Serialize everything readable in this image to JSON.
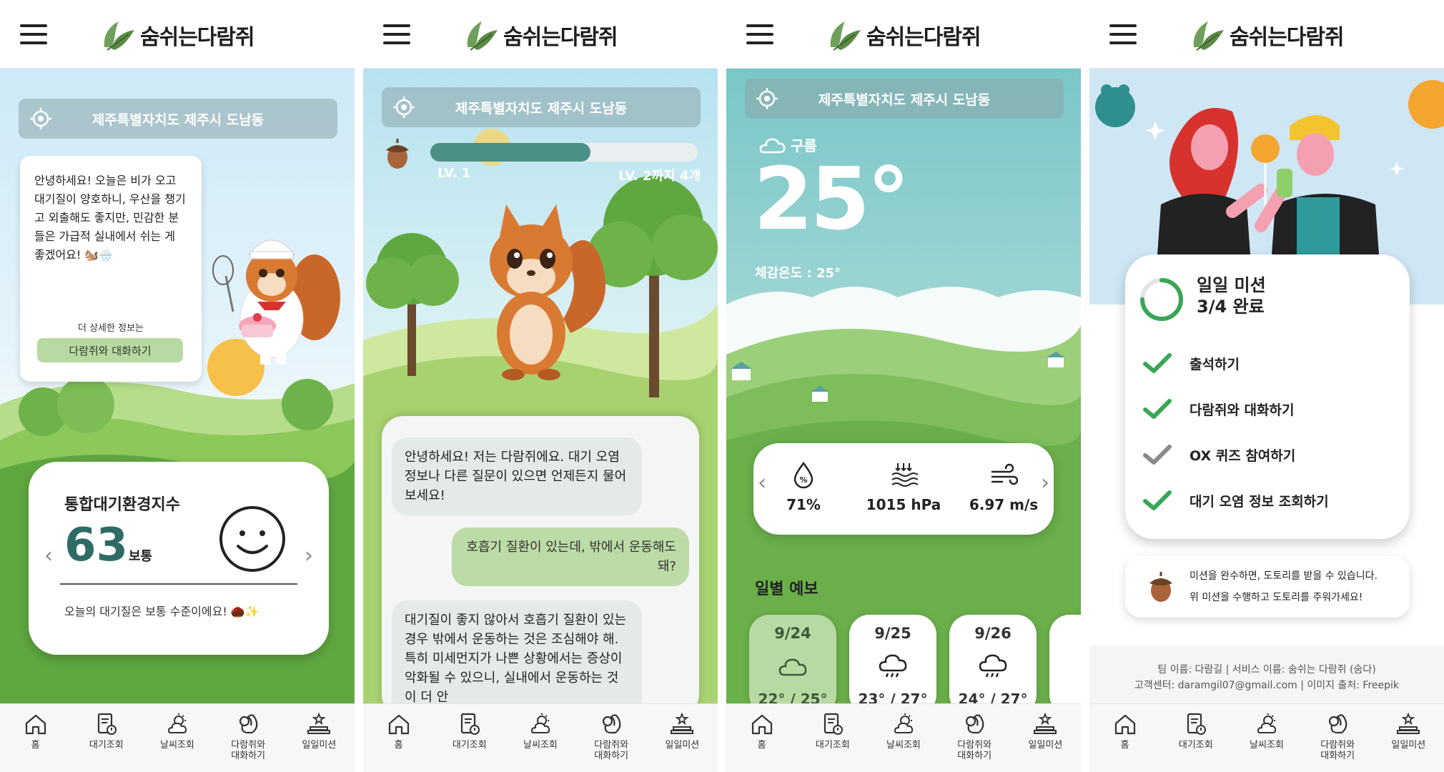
{
  "app": {
    "logo_text": "숨쉬는다람쥐",
    "nav": [
      {
        "label": "홈"
      },
      {
        "label": "대기조회"
      },
      {
        "label": "날씨조회"
      },
      {
        "label": "다람쥐와\n대화하기"
      },
      {
        "label": "일일미션"
      }
    ]
  },
  "location": "제주특별자치도 제주시 도남동",
  "home": {
    "greeting": "안녕하세요! 오늘은 비가 오고 대기질이 양호하니, 우산을 챙기고 외출해도 좋지만, 민감한 분들은 가급적 실내에서 쉬는 게 좋겠어요! 🐿️🌧️",
    "more_label": "더 상세한 정보는",
    "chat_button": "다람쥐와 대화하기",
    "aqi_title": "통합대기환경지수",
    "aqi_value": "63",
    "aqi_status": "보통",
    "aqi_message": "오늘의 대기질은 보통 수준이에요! 🌰✨"
  },
  "chat": {
    "level": {
      "current": "LV. 1",
      "next": "LV. 2까지 4개",
      "progress": 0.6
    },
    "messages": [
      {
        "role": "bot",
        "text": "안녕하세요! 저는 다람쥐에요. 대기 오염 정보나 다른 질문이 있으면 언제든지 물어보세요!"
      },
      {
        "role": "user",
        "text": "호흡기 질환이 있는데, 밖에서 운동해도 돼?"
      },
      {
        "role": "bot",
        "text": "대기질이 좋지 않아서 호흡기 질환이 있는 경우 밖에서 운동하는 것은 조심해야 해. 특히 미세먼지가 나쁜 상황에서는 증상이 악화될 수 있으니, 실내에서 운동하는 것이 더 안"
      }
    ]
  },
  "weather": {
    "condition": "구름",
    "temperature": "25°",
    "feels_like": "체감온도 : 25°",
    "humidity": "71%",
    "pressure": "1015 hPa",
    "wind": "6.97 m/s",
    "forecast_title": "일별 예보",
    "forecast": [
      {
        "date": "9/24",
        "temp": "22° / 25°",
        "icon": "cloud-icon"
      },
      {
        "date": "9/25",
        "temp": "23° / 27°",
        "icon": "rain-cloud-icon"
      },
      {
        "date": "9/26",
        "temp": "24° / 27°",
        "icon": "rain-cloud-icon"
      }
    ]
  },
  "mission": {
    "title": "일일 미션",
    "progress_text": "3/4 완료",
    "progress": 0.75,
    "items": [
      {
        "label": "출석하기",
        "done": true
      },
      {
        "label": "다람쥐와 대화하기",
        "done": true
      },
      {
        "label": "OX 퀴즈 참여하기",
        "done": false
      },
      {
        "label": "대기 오염 정보 조회하기",
        "done": true
      }
    ],
    "reward_line1": "미션을 완수하면, 도토리를 받을 수 있습니다.",
    "reward_line2": "위 미션을 수행하고 도토리를 주워가세요!",
    "footer_line1": "팀 이름: 다람길 | 서비스 이름: 숨쉬는 다람쥐 (숨다)",
    "footer_line2": "고객센터: daramgil07@gmail.com | 이미지 출처: Freepik"
  },
  "colors": {
    "accent_green": "#b9d9a3",
    "teal": "#2e6b64",
    "check_green": "#3aa655"
  }
}
